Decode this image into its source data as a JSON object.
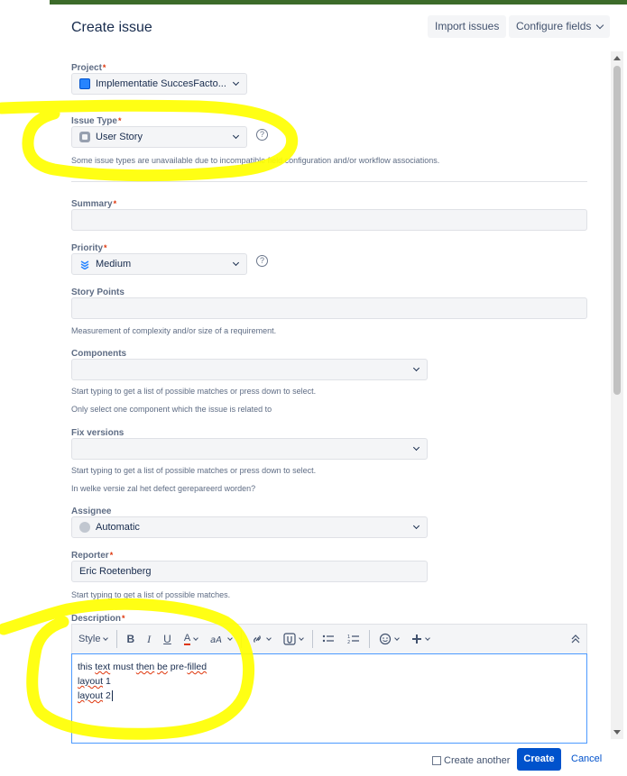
{
  "dialog": {
    "title": "Create issue",
    "import_label": "Import issues",
    "configure_label": "Configure fields"
  },
  "fields": {
    "project": {
      "label": "Project",
      "value": "Implementatie SuccesFacto..."
    },
    "issue_type": {
      "label": "Issue Type",
      "value": "User Story",
      "help": "Some issue types are unavailable due to incompatible field configuration and/or workflow associations."
    },
    "summary": {
      "label": "Summary",
      "value": ""
    },
    "priority": {
      "label": "Priority",
      "value": "Medium"
    },
    "story_points": {
      "label": "Story Points",
      "value": "",
      "help": "Measurement of complexity and/or size of a requirement."
    },
    "components": {
      "label": "Components",
      "value": "",
      "help1": "Start typing to get a list of possible matches or press down to select.",
      "help2": "Only select one component which the issue is related to"
    },
    "fix_versions": {
      "label": "Fix versions",
      "value": "",
      "help1": "Start typing to get a list of possible matches or press down to select.",
      "help2": "In welke versie zal het defect gerepareerd worden?"
    },
    "assignee": {
      "label": "Assignee",
      "value": "Automatic"
    },
    "reporter": {
      "label": "Reporter",
      "value": "Eric Roetenberg",
      "help": "Start typing to get a list of possible matches."
    },
    "description": {
      "label": "Description",
      "toolbar": {
        "style_label": "Style",
        "bold": "B",
        "italic": "I",
        "underline": "U",
        "text_color": "A"
      },
      "lines": {
        "l1": {
          "w1": "this",
          "w2": "text",
          "w3": "must",
          "w4": "then",
          "w5": "be",
          "w6": "pre-",
          "w7": "filled"
        },
        "l2": {
          "w1": "layout",
          "w2": "1"
        },
        "l3": {
          "w1": "layout",
          "w2": "2"
        }
      }
    }
  },
  "footer": {
    "create_another_label": "Create another",
    "create_another_checked": false,
    "create_label": "Create",
    "cancel_label": "Cancel"
  },
  "required_marker": "*",
  "help_glyph": "?",
  "colors": {
    "primary": "#0052cc",
    "required": "#de350b",
    "highlight": "#ffff00",
    "header_strip": "#3c6b2a",
    "focus": "#4c9aff"
  }
}
